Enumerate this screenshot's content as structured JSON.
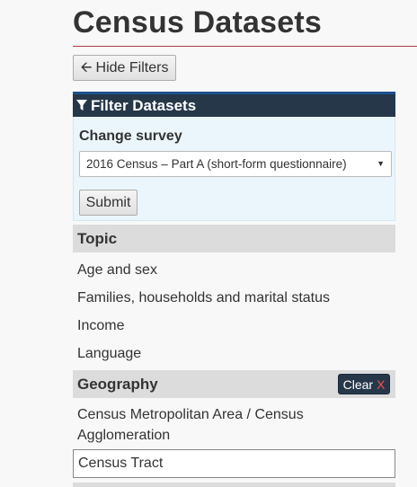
{
  "page": {
    "title": "Census Datasets"
  },
  "toolbar": {
    "hide_filters_label": "Hide Filters",
    "hide_icon": "arrow-left-icon"
  },
  "filter_panel": {
    "title": "Filter Datasets",
    "icon": "filter-icon",
    "change_survey_label": "Change survey",
    "survey_selected": "2016 Census – Part A (short-form questionnaire)",
    "submit_label": "Submit"
  },
  "topic": {
    "heading": "Topic",
    "items": [
      "Age and sex",
      "Families, households and marital status",
      "Income",
      "Language"
    ]
  },
  "geography": {
    "heading": "Geography",
    "clear_label": "Clear",
    "clear_x": "X",
    "items": [
      "Census Metropolitan Area / Census Agglomeration",
      "Census Tract"
    ]
  },
  "colors": {
    "header_bg": "#26374a",
    "header_accent": "#1e4f8c",
    "rule": "#af3c43",
    "section_bg": "#dcdcdc",
    "panel_bg": "#eaf6fb"
  }
}
